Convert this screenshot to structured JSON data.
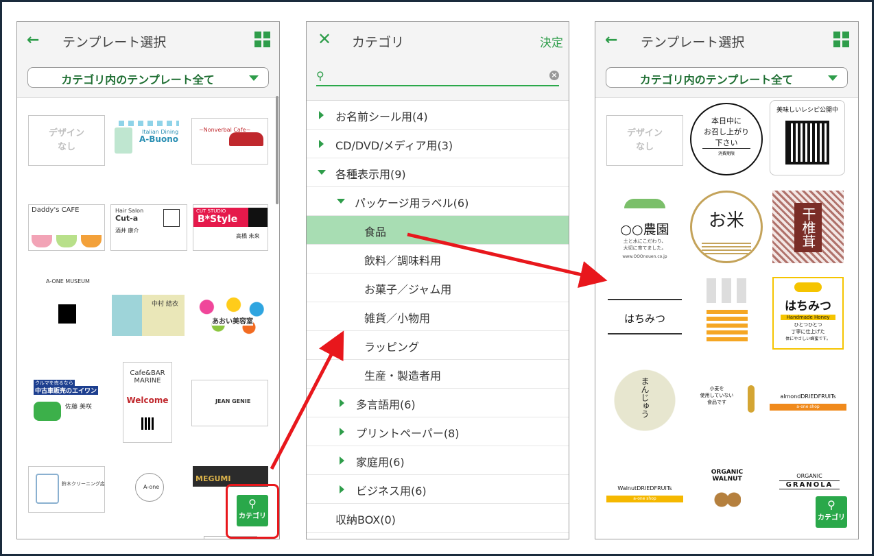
{
  "panel_left": {
    "title": "テンプレート選択",
    "dropdown": "カテゴリ内のテンプレート全て",
    "no_design": "デザインなし",
    "cards": {
      "daddys": "Daddy's CAFE",
      "abuono_sub": "Italian Dining",
      "abuono": "A-Buono",
      "nonverbal": "~Nonverbal Cafe~",
      "hair_salon": "Hair Salon",
      "cuta": "Cut-a",
      "cuta_name": "酒井 康介",
      "bstyle_top": "CUT STUDIO",
      "bstyle": "B*Style",
      "bstyle_name": "高橋 未来",
      "museum": "A-ONE MUSEUM",
      "nakamura": "中村 結衣",
      "aoi": "あおい美容室",
      "car_top": "クルマを売るなら",
      "car_shop": "中古車販売のエイワン",
      "car_name": "佐藤 美咲",
      "cafebar": "Cafe&BAR",
      "marine": "MARINE",
      "welcome": "Welcome",
      "jean": "JEAN GENIE",
      "cleaning": "鈴木クリーニング店",
      "aone": "A-one",
      "megumi": "MEGUMI"
    },
    "category_button": "カテゴリ"
  },
  "panel_middle": {
    "title": "カテゴリ",
    "confirm": "決定",
    "search_placeholder": "",
    "items": [
      {
        "label": "お名前シール用(4)"
      },
      {
        "label": "CD/DVD/メディア用(3)"
      },
      {
        "label": "各種表示用(9)"
      },
      {
        "label": "パッケージ用ラベル(6)"
      },
      {
        "label": "食品"
      },
      {
        "label": "飲料／調味料用"
      },
      {
        "label": "お菓子／ジャム用"
      },
      {
        "label": "雑貨／小物用"
      },
      {
        "label": "ラッピング"
      },
      {
        "label": "生産・製造者用"
      },
      {
        "label": "多言語用(6)"
      },
      {
        "label": "プリントペーパー(8)"
      },
      {
        "label": "家庭用(6)"
      },
      {
        "label": "ビジネス用(6)"
      },
      {
        "label": "収納BOX(0)"
      }
    ]
  },
  "panel_right": {
    "title": "テンプレート選択",
    "dropdown": "カテゴリ内のテンプレート全て",
    "no_design": "デザインなし",
    "labels": {
      "honjitsu_1": "本日中に",
      "honjitsu_2": "お召し上がり",
      "honjitsu_3": "下さい",
      "honjitsu_4": "消費期限",
      "recipe": "美味しいレシピ公開中",
      "farm": "○○農園",
      "farm_sub1": "土と水にこだわり、",
      "farm_sub2": "大切に育てました。",
      "farm_url": "www.OOOnouen.co.jp",
      "rice": "お米",
      "shiitake": "干椎茸",
      "hachimitsu": "はちみつ",
      "hachimitsu2": "はちみつ",
      "honey_en": "Handmade Honey",
      "honey_sub1": "ひとつひとつ",
      "honey_sub2": "丁寧に仕上げた",
      "honey_sub3": "体にやさしい蜂蜜です。",
      "manju": "まんじゅう",
      "komugi1": "小麦を",
      "komugi2": "使用していない",
      "komugi3": "食品です",
      "almond": "almondDRIEDFRUITs",
      "aone_shop": "a-one shop",
      "walnut_fruits": "WalnutDRIEDFRUITs",
      "organic": "ORGANIC",
      "walnut": "WALNUT",
      "organic2": "ORGANIC",
      "granola": "GRANOLA"
    },
    "category_button": "カテゴリ"
  }
}
